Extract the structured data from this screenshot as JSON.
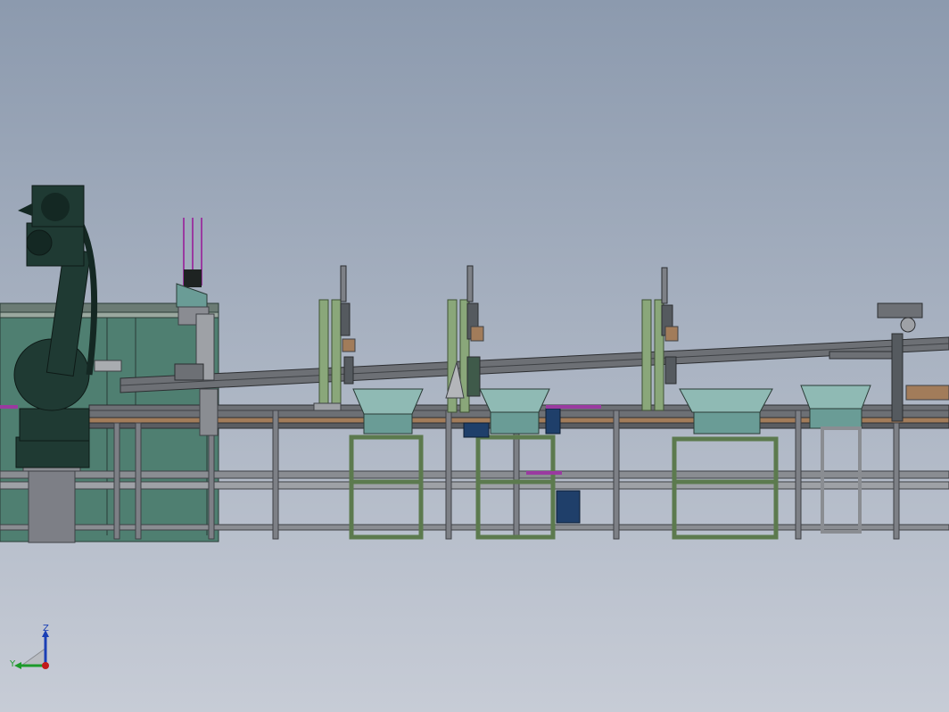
{
  "viewport": {
    "background_top": "#8c9aae",
    "background_bottom": "#c7ccd6"
  },
  "colors": {
    "frame_green": "#5c7a4e",
    "frame_green_light": "#8aa77a",
    "bowl": "#6a9c96",
    "bowl_light": "#8fbab4",
    "robot": "#1f3a33",
    "robot_dark": "#142823",
    "conveyor_steel": "#6d7075",
    "conveyor_dark": "#3e4145",
    "rail_brown": "#a27c5a",
    "enclosure": "#4f7f71",
    "pedestal": "#7d7f86",
    "motor_blue": "#1f3f6a",
    "magenta_accent": "#9a3aa0"
  },
  "triad": {
    "z_label": "Z",
    "y_label": "Y",
    "z_color": "#1a3fb5",
    "y_color": "#1c9a2a",
    "x_color": "#c21a1a"
  },
  "icons": {
    "triad": "coordinate-triad-icon",
    "robot": "industrial-robot-arm",
    "bowl_feeder": "vibratory-bowl-feeder"
  }
}
